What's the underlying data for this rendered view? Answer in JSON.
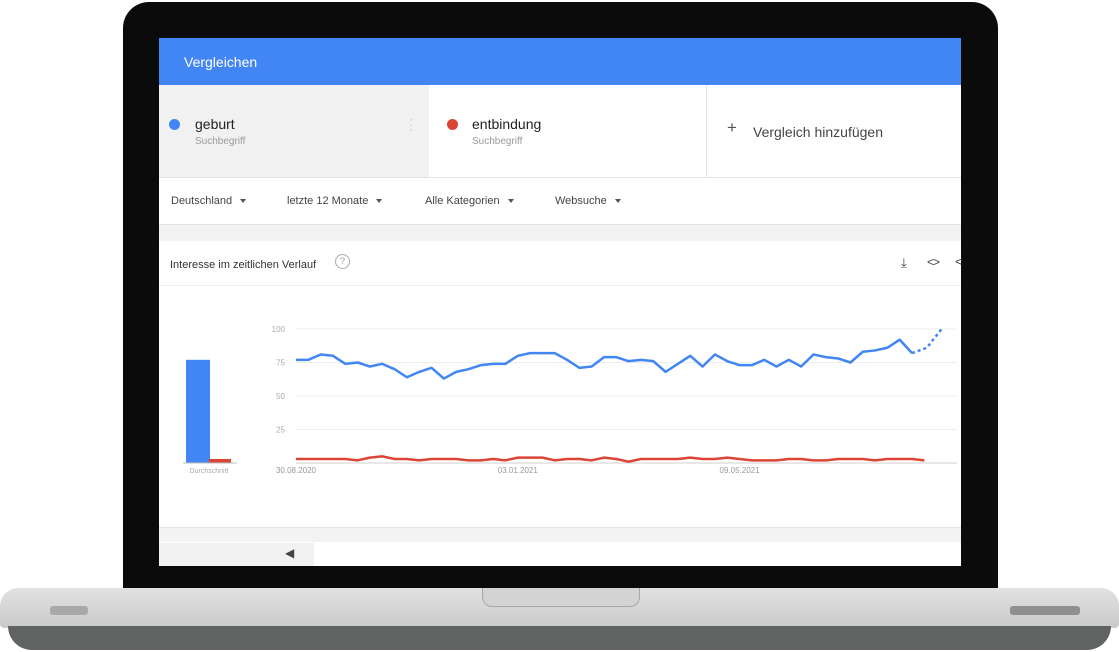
{
  "header": {
    "title": "Vergleichen"
  },
  "terms": [
    {
      "name": "geburt",
      "type": "Suchbegriff",
      "color": "#4285f4"
    },
    {
      "name": "entbindung",
      "type": "Suchbegriff",
      "color": "#db4437"
    }
  ],
  "add_compare": {
    "icon": "plus-icon",
    "label": "Vergleich hinzufügen"
  },
  "filters": {
    "region": "Deutschland",
    "time": "letzte 12 Monate",
    "category": "Alle Kategorien",
    "search_type": "Websuche"
  },
  "card": {
    "title": "Interesse im zeitlichen Verlauf",
    "help_icon": "help-circle-icon",
    "actions": [
      "download-icon",
      "embed-code-icon",
      "share-icon"
    ]
  },
  "chart_data": {
    "type": "line",
    "y_ticks": [
      100,
      75,
      50,
      25
    ],
    "ylim": [
      0,
      100
    ],
    "x_labels": [
      {
        "label": "30.08.2020",
        "index": 0
      },
      {
        "label": "03.01.2021",
        "index": 18
      },
      {
        "label": "09.05.2021",
        "index": 36
      }
    ],
    "average_label": "Durchschnitt",
    "averages": [
      {
        "name": "geburt",
        "value": 77,
        "color": "#4285f4"
      },
      {
        "name": "entbindung",
        "value": 3,
        "color": "#db4437"
      }
    ],
    "series": [
      {
        "name": "geburt",
        "color": "#4285f4",
        "values": [
          77,
          77,
          81,
          80,
          74,
          75,
          72,
          74,
          70,
          64,
          68,
          71,
          63,
          68,
          70,
          73,
          74,
          74,
          80,
          82,
          82,
          82,
          77,
          71,
          72,
          79,
          79,
          76,
          77,
          76,
          68,
          74,
          80,
          72,
          81,
          76,
          73,
          73,
          77,
          72,
          77,
          72,
          81,
          79,
          78,
          75,
          83,
          84,
          86,
          92,
          82
        ],
        "partial_tail": [
          82,
          86,
          100
        ]
      },
      {
        "name": "entbindung",
        "color": "#db4437",
        "values": [
          3,
          3,
          3,
          3,
          3,
          2,
          4,
          5,
          3,
          3,
          2,
          3,
          3,
          3,
          2,
          2,
          3,
          2,
          4,
          4,
          4,
          2,
          3,
          3,
          2,
          4,
          3,
          1,
          3,
          3,
          3,
          3,
          4,
          3,
          3,
          4,
          3,
          2,
          2,
          2,
          3,
          3,
          2,
          2,
          3,
          3,
          3,
          2,
          3,
          3,
          3,
          2
        ]
      }
    ]
  },
  "footer": {
    "scroll_icon": "chevron-left-icon"
  }
}
